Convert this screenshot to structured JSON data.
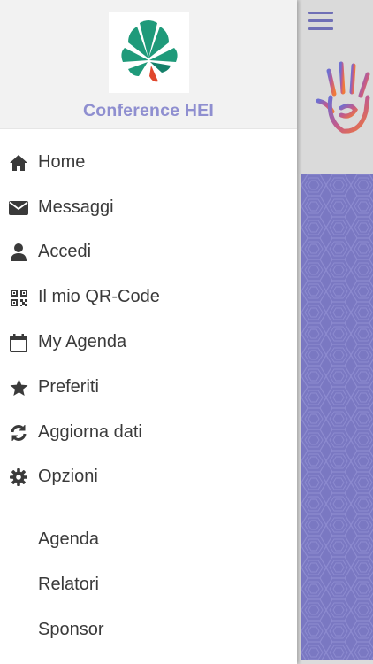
{
  "drawer": {
    "title": "Conference HEI",
    "menu": [
      {
        "label": "Home",
        "icon": "home-icon"
      },
      {
        "label": "Messaggi",
        "icon": "envelope-icon"
      },
      {
        "label": "Accedi",
        "icon": "user-icon"
      },
      {
        "label": "Il mio QR-Code",
        "icon": "qr-code-icon"
      },
      {
        "label": "My Agenda",
        "icon": "calendar-icon"
      },
      {
        "label": "Preferiti",
        "icon": "star-icon"
      },
      {
        "label": "Aggiorna dati",
        "icon": "refresh-icon"
      },
      {
        "label": "Opzioni",
        "icon": "gear-icon"
      }
    ],
    "secondary": [
      {
        "label": "Agenda"
      },
      {
        "label": "Relatori"
      },
      {
        "label": "Sponsor"
      }
    ]
  },
  "colors": {
    "accent": "#8f8fd0",
    "pattern": "#7a78c2",
    "icon": "#3a3a3a",
    "logo_leaf": "#1f9a7a",
    "logo_accent": "#e0472d"
  }
}
